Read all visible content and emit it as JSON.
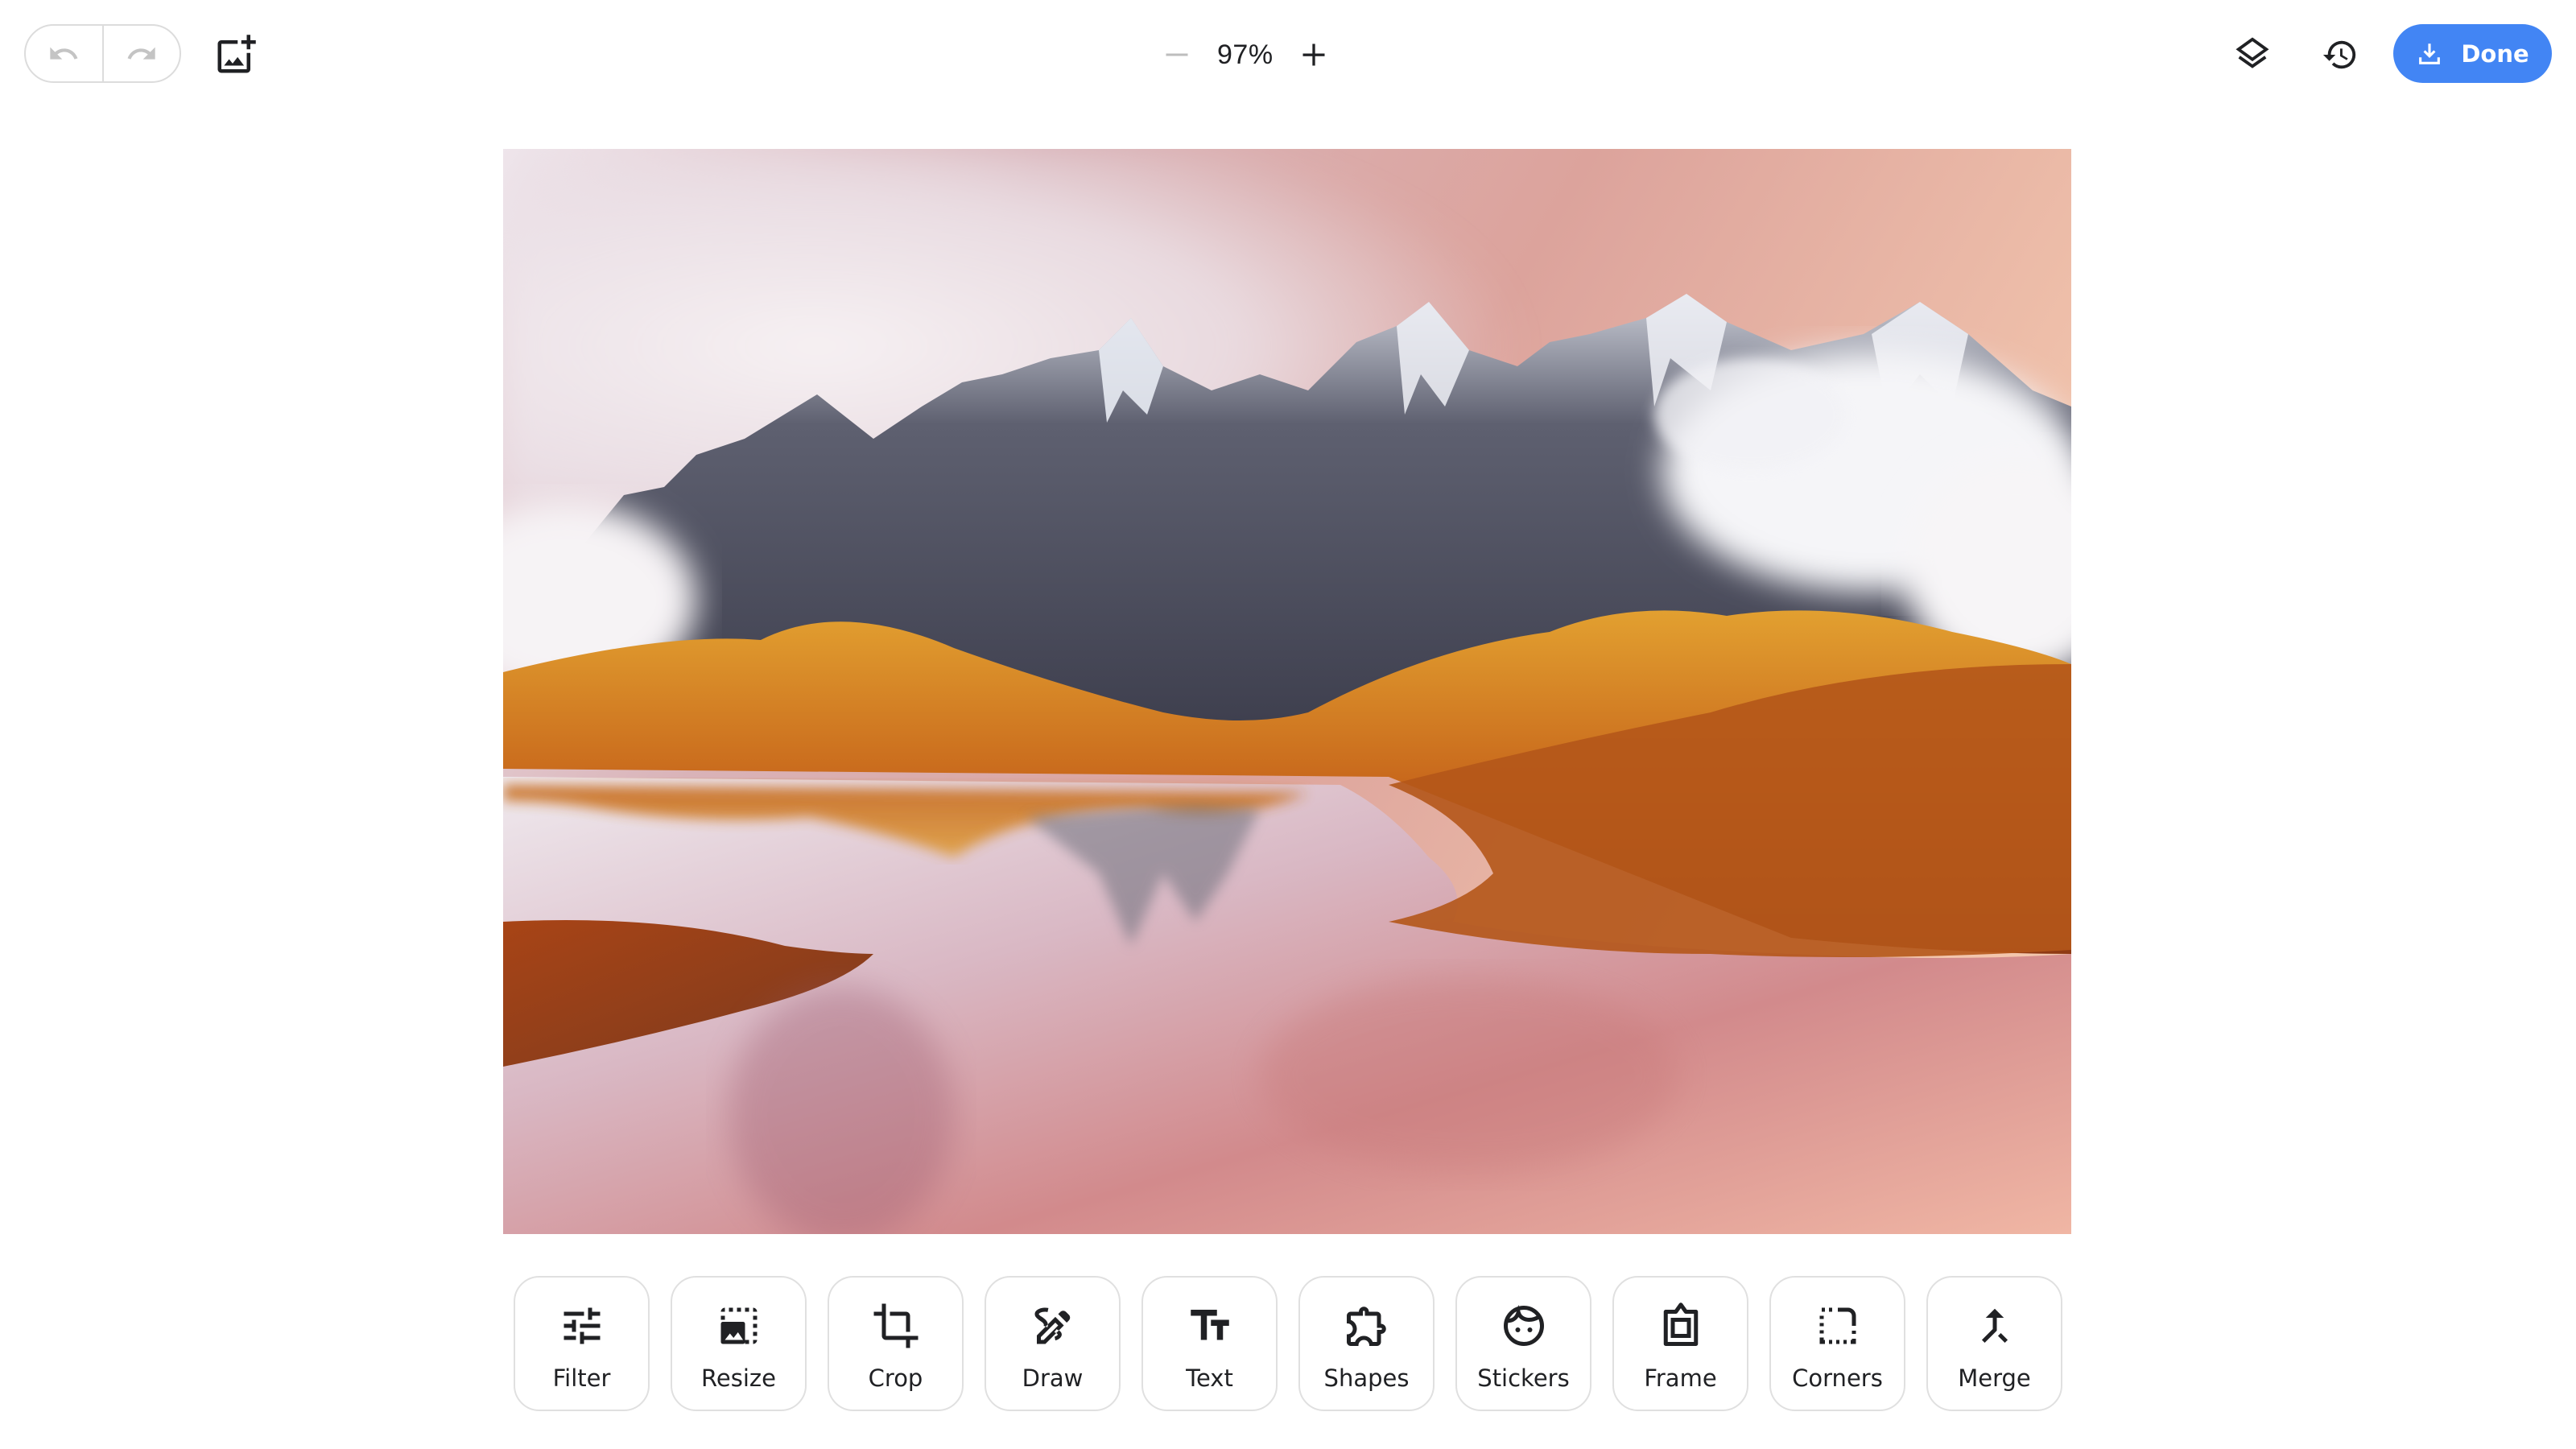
{
  "toolbar": {
    "undo_icon": "undo-icon",
    "redo_icon": "redo-icon",
    "add_image_icon": "add-image-icon",
    "zoom_out_icon": "minus-icon",
    "zoom_level": "97%",
    "zoom_in_icon": "plus-icon",
    "layers_icon": "layers-icon",
    "history_icon": "history-icon",
    "done_label": "Done",
    "done_icon": "download-icon",
    "accent_color": "#4285F4"
  },
  "canvas": {
    "image_description": "Snow-capped mountain range above golden-orange grassy hills reflected in a pink-tinted lake under a pastel pink sky"
  },
  "tools": [
    {
      "label": "Filter",
      "icon": "sliders-icon"
    },
    {
      "label": "Resize",
      "icon": "resize-icon"
    },
    {
      "label": "Crop",
      "icon": "crop-icon"
    },
    {
      "label": "Draw",
      "icon": "draw-icon"
    },
    {
      "label": "Text",
      "icon": "text-icon"
    },
    {
      "label": "Shapes",
      "icon": "puzzle-icon"
    },
    {
      "label": "Stickers",
      "icon": "face-icon"
    },
    {
      "label": "Frame",
      "icon": "frame-icon"
    },
    {
      "label": "Corners",
      "icon": "corners-icon"
    },
    {
      "label": "Merge",
      "icon": "merge-icon"
    }
  ]
}
